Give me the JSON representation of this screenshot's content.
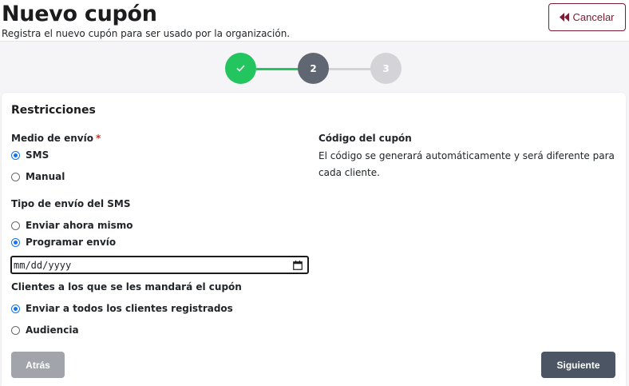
{
  "header": {
    "title": "Nuevo cupón",
    "subtitle": "Registra el nuevo cupón para ser usado por la organización.",
    "cancel_label": "Cancelar"
  },
  "stepper": {
    "steps": [
      {
        "label": "",
        "state": "complete",
        "icon": "check-icon"
      },
      {
        "label": "2",
        "state": "current"
      },
      {
        "label": "3",
        "state": "pending"
      }
    ],
    "colors": {
      "complete": "#22c55e",
      "current": "#616772",
      "pending": "#d4d4d8"
    }
  },
  "form": {
    "section_title": "Restricciones",
    "delivery_method": {
      "label": "Medio de envío",
      "required_mark": "*",
      "options": [
        {
          "label": "SMS",
          "checked": true
        },
        {
          "label": "Manual",
          "checked": false
        }
      ]
    },
    "sms_type": {
      "label": "Tipo de envío del SMS",
      "options": [
        {
          "label": "Enviar ahora mismo",
          "checked": false
        },
        {
          "label": "Programar envío",
          "checked": true
        }
      ],
      "date_placeholder": "mm/dd/yyyy"
    },
    "clients": {
      "label": "Clientes a los que se les mandará el cupón",
      "options": [
        {
          "label": "Enviar a todos los clientes registrados",
          "checked": true
        },
        {
          "label": "Audiencia",
          "checked": false
        }
      ]
    },
    "coupon_code": {
      "label": "Código del cupón",
      "description": "El código se generará automáticamente y será diferente para cada cliente."
    }
  },
  "footer": {
    "back_label": "Atrás",
    "next_label": "Siguiente"
  },
  "colors": {
    "accent": "#1a73e8",
    "cancel_brand": "#7a1c32",
    "required": "#dc2626"
  }
}
